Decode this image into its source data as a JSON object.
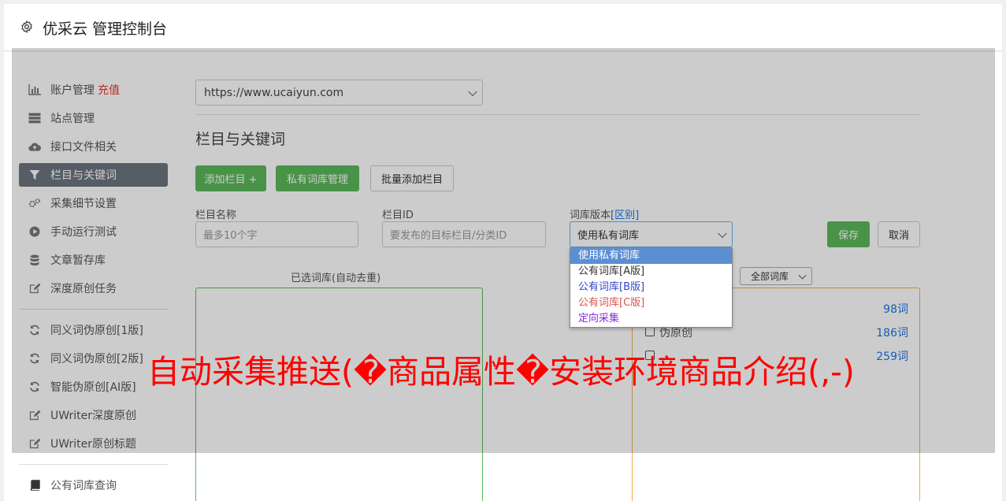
{
  "header": {
    "title": "优采云 管理控制台"
  },
  "sidebar": {
    "group1": [
      {
        "label": "账户管理",
        "extra": "充值",
        "icon": "bar-chart-icon"
      },
      {
        "label": "站点管理",
        "icon": "server-icon"
      },
      {
        "label": "接口文件相关",
        "icon": "cloud-upload-icon"
      },
      {
        "label": "栏目与关键词",
        "icon": "filter-icon",
        "active": true
      },
      {
        "label": "采集细节设置",
        "icon": "gears-icon"
      },
      {
        "label": "手动运行测试",
        "icon": "play-circle-icon"
      },
      {
        "label": "文章暂存库",
        "icon": "database-icon"
      },
      {
        "label": "深度原创任务",
        "icon": "edit-icon"
      }
    ],
    "group2": [
      {
        "label": "同义词伪原创[1版]",
        "icon": "refresh-icon"
      },
      {
        "label": "同义词伪原创[2版]",
        "icon": "refresh-icon"
      },
      {
        "label": "智能伪原创[AI版]",
        "icon": "refresh-icon"
      },
      {
        "label": "UWriter深度原创",
        "icon": "edit-icon"
      },
      {
        "label": "UWriter原创标题",
        "icon": "edit-icon"
      }
    ],
    "group3": [
      {
        "label": "公有词库查询",
        "icon": "book-icon"
      }
    ]
  },
  "main": {
    "site_select": "https://www.ucaiyun.com",
    "section_title": "栏目与关键词",
    "buttons": {
      "add_column": "添加栏目 +",
      "private_lib": "私有词库管理",
      "batch_add": "批量添加栏目",
      "save": "保存",
      "cancel": "取消"
    },
    "fields": {
      "column_name_label": "栏目名称",
      "column_name_placeholder": "最多10个字",
      "column_id_label": "栏目ID",
      "column_id_placeholder": "要发布的目标栏目/分类ID",
      "lib_version_label": "词库版本",
      "lib_version_link": "[区别]",
      "lib_version_value": "使用私有词库"
    },
    "selected_label": "已选词库(自动去重)",
    "all_libs_select": "全部词库",
    "libraries": [
      {
        "name": "",
        "count": "98词"
      },
      {
        "name": "伪原创",
        "count": "186词"
      },
      {
        "name": "",
        "count": "259词"
      }
    ]
  },
  "dropdown": {
    "options": [
      {
        "label": "使用私有词库",
        "color": "#ffffff",
        "highlighted": true
      },
      {
        "label": "公有词库[A版]",
        "color": "#333333"
      },
      {
        "label": "公有词库[B版]",
        "color": "#3344cc"
      },
      {
        "label": "公有词库[C版]",
        "color": "#d9534f"
      },
      {
        "label": "定向采集",
        "color": "#8a2be2"
      }
    ]
  },
  "watermark": "自动采集推送(�商品属性�安装环境商品介绍(,-)"
}
